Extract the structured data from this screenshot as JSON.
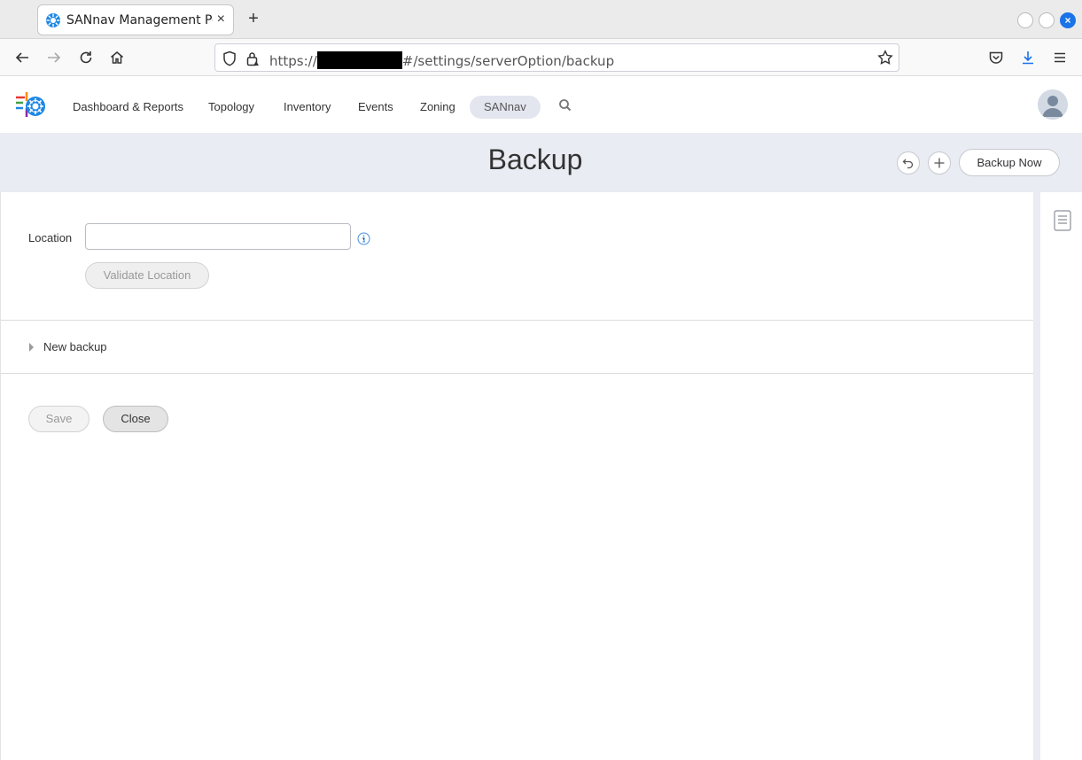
{
  "browser": {
    "tab_title": "SANnav Management Portal",
    "new_tab_label": "+",
    "tab_close_label": "×",
    "url_prefix": "https://",
    "url_path": "#/settings/serverOption/backup",
    "window_close_label": "×"
  },
  "app": {
    "menu": [
      {
        "label": "Dashboard & Reports"
      },
      {
        "label": "Topology"
      },
      {
        "label": "Inventory"
      },
      {
        "label": "Events"
      },
      {
        "label": "Zoning"
      },
      {
        "label": "SANnav"
      }
    ],
    "active_menu": "SANnav"
  },
  "page": {
    "title": "Backup",
    "backup_now_label": "Backup Now",
    "location_label": "Location",
    "location_value": "",
    "location_placeholder": "",
    "validate_label": "Validate Location",
    "section_label": "New backup",
    "save_label": "Save",
    "close_label": "Close"
  },
  "colors": {
    "accent": "#1a73e8",
    "band": "#e9ecf2",
    "active_pill": "#e3e6ef"
  },
  "icons": [
    "back-arrow-icon",
    "forward-arrow-icon",
    "reload-icon",
    "home-icon",
    "shield-icon",
    "lock-icon",
    "star-icon",
    "pocket-icon",
    "download-icon",
    "menu-icon",
    "search-icon",
    "undo-icon",
    "plus-icon",
    "info-icon",
    "document-icon",
    "user-avatar-icon"
  ]
}
